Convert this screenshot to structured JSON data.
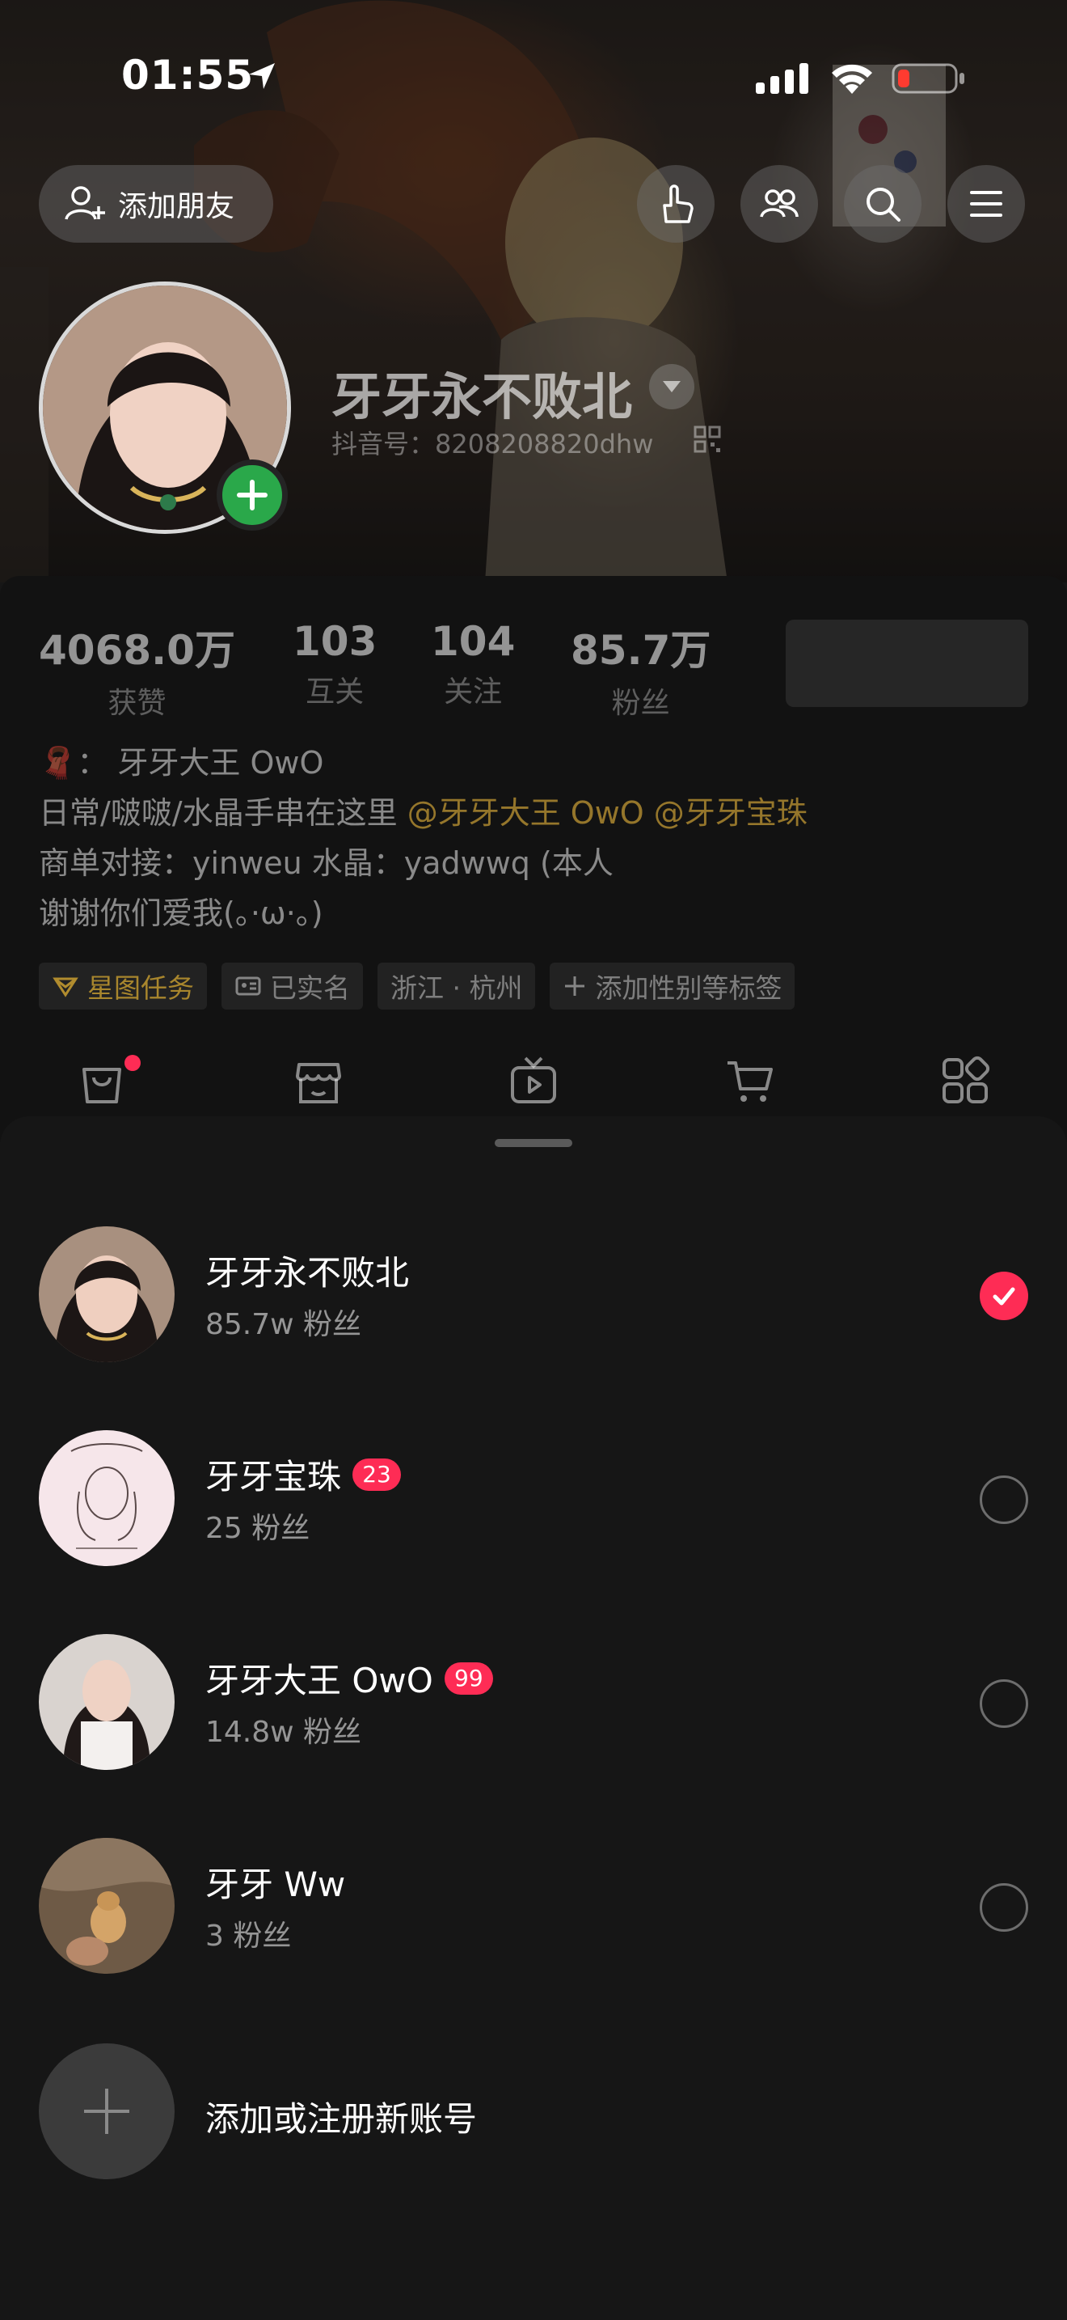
{
  "status_bar": {
    "time": "01:55",
    "battery_color": "#ff3b30"
  },
  "header": {
    "add_friend_label": "添加朋友",
    "buttons": [
      "hand-gesture-icon",
      "friends-icon",
      "search-icon",
      "menu-icon"
    ]
  },
  "profile": {
    "name": "牙牙永不败北",
    "douyin_id": "抖音号：8208208820dhw",
    "stats": [
      {
        "value": "4068.0万",
        "label": "获赞"
      },
      {
        "value": "103",
        "label": "互关"
      },
      {
        "value": "104",
        "label": "关注"
      },
      {
        "value": "85.7万",
        "label": "粉丝"
      }
    ],
    "bio": {
      "line1_emoji": "🧣",
      "line1": "： 牙牙大王 OwO",
      "line2_prefix": "日常/啵啵/水晶手串在这里",
      "mention1": "@牙牙大王 OwO",
      "mention2": "@牙牙宝珠",
      "line3": "商单对接：yinweu  水晶：yadwwq (本人",
      "line4": "谢谢你们爱我(。·ω·。)"
    },
    "tags": [
      "星图任务",
      "已实名",
      "浙江 · 杭州",
      "添加性别等标签"
    ],
    "tab_icons": [
      "bag-icon",
      "store-icon",
      "tv-icon",
      "cart-icon",
      "apps-icon"
    ]
  },
  "sheet": {
    "accounts": [
      {
        "name": "牙牙永不败北",
        "followers": "85.7w 粉丝",
        "badge": "",
        "selected": true
      },
      {
        "name": "牙牙宝珠",
        "followers": "25 粉丝",
        "badge": "23",
        "selected": false
      },
      {
        "name": "牙牙大王 OwO",
        "followers": "14.8w 粉丝",
        "badge": "99",
        "selected": false
      },
      {
        "name": "牙牙 Ww",
        "followers": "3 粉丝",
        "badge": "",
        "selected": false
      }
    ],
    "add_account_label": "添加或注册新账号"
  },
  "colors": {
    "accent": "#fe2c55",
    "mention": "#e6b43c",
    "plus_badge": "#2aa84a"
  }
}
